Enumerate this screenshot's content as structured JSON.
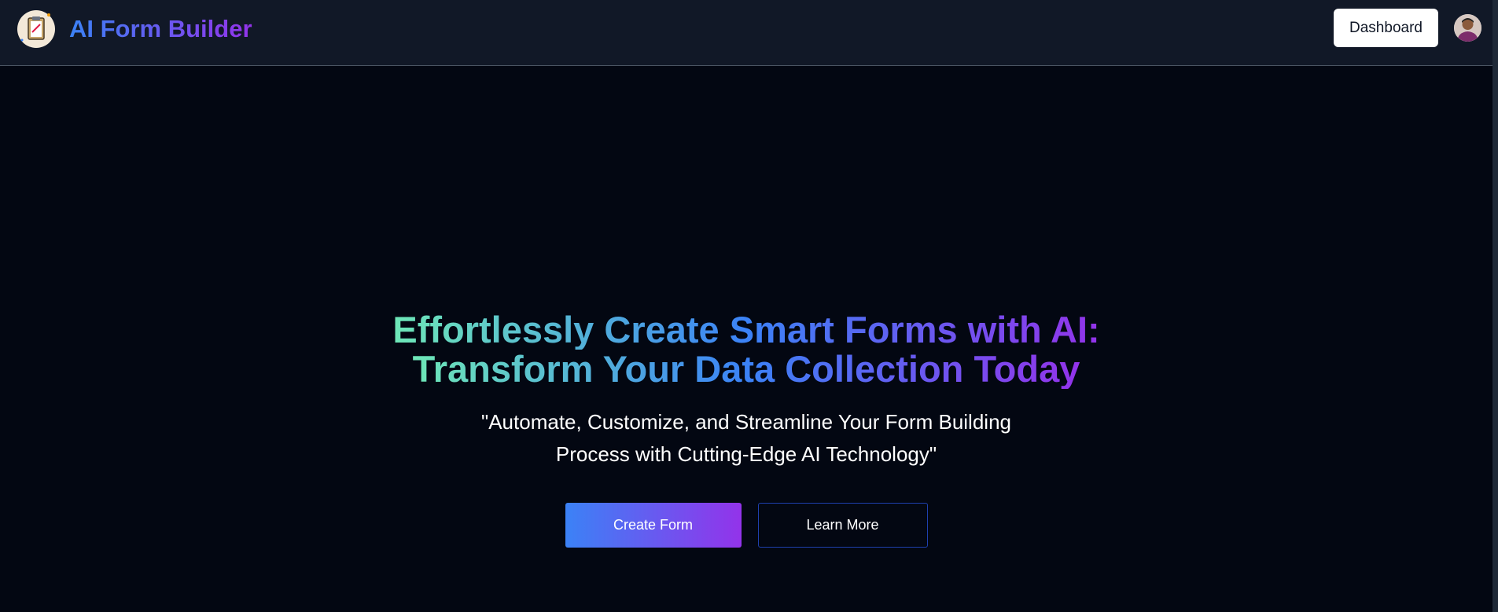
{
  "header": {
    "brand": "AI Form Builder",
    "dashboard_label": "Dashboard"
  },
  "hero": {
    "headline_line1": "Effortlessly Create Smart Forms with AI:",
    "headline_line2": "Transform Your Data Collection Today",
    "subtitle": "\"Automate, Customize, and Streamline Your Form Building Process with Cutting-Edge AI Technology\"",
    "create_label": "Create Form",
    "learn_label": "Learn More"
  },
  "icons": {
    "logo": "clipboard-icon",
    "avatar": "user-avatar"
  },
  "colors": {
    "background": "#030712",
    "header": "#111827",
    "gradient_start": "#3b82f6",
    "gradient_end": "#9333ea",
    "headline_start": "#6ee7b7"
  }
}
